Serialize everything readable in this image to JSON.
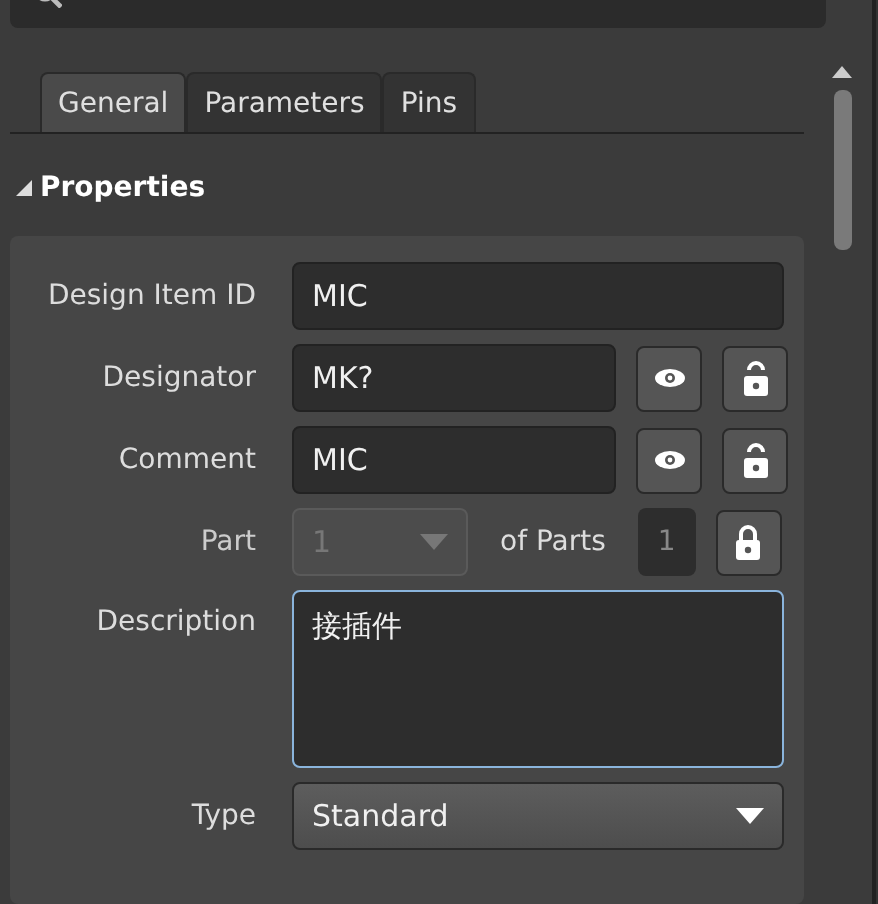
{
  "tabs": [
    {
      "label": "General",
      "selected": true
    },
    {
      "label": "Parameters",
      "selected": false
    },
    {
      "label": "Pins",
      "selected": false
    }
  ],
  "section": {
    "title": "Properties",
    "expanded": true
  },
  "rows": [
    {
      "kind": "text",
      "label": "Design Item ID",
      "value": "MIC"
    },
    {
      "kind": "text",
      "label": "Designator",
      "value": "MK?",
      "visible": true,
      "locked": false
    },
    {
      "kind": "text",
      "label": "Comment",
      "value": "MIC",
      "visible": true,
      "locked": false
    },
    {
      "kind": "part",
      "label": "Part",
      "value": "1",
      "disabled": true,
      "of_label": "of Parts",
      "count": "1",
      "locked": true
    },
    {
      "kind": "area",
      "label": "Description",
      "value": "接插件",
      "focused": true
    },
    {
      "kind": "select",
      "label": "Type",
      "value": "Standard"
    }
  ]
}
